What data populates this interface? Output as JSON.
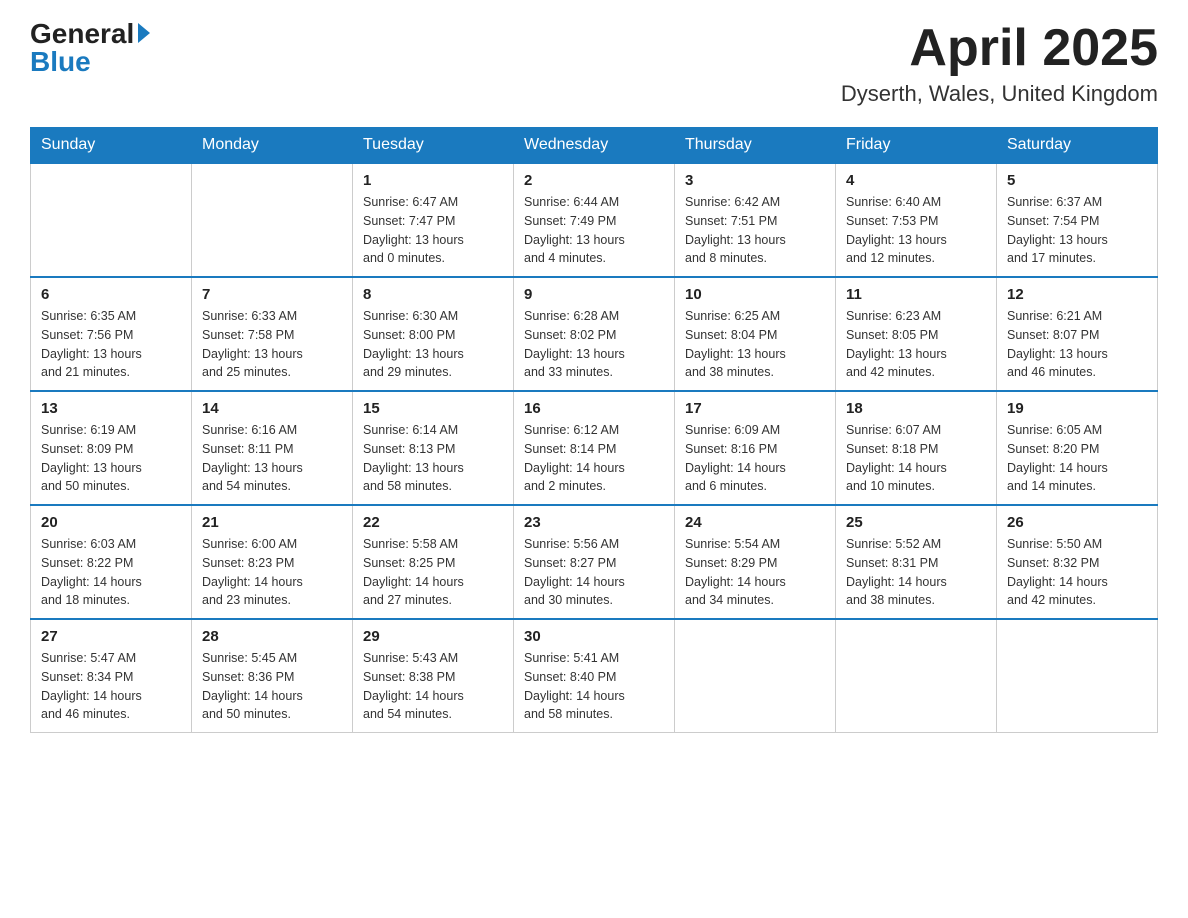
{
  "logo": {
    "general": "General",
    "blue": "Blue"
  },
  "title": {
    "month_year": "April 2025",
    "location": "Dyserth, Wales, United Kingdom"
  },
  "days_of_week": [
    "Sunday",
    "Monday",
    "Tuesday",
    "Wednesday",
    "Thursday",
    "Friday",
    "Saturday"
  ],
  "weeks": [
    [
      {
        "day": "",
        "info": ""
      },
      {
        "day": "",
        "info": ""
      },
      {
        "day": "1",
        "info": "Sunrise: 6:47 AM\nSunset: 7:47 PM\nDaylight: 13 hours\nand 0 minutes."
      },
      {
        "day": "2",
        "info": "Sunrise: 6:44 AM\nSunset: 7:49 PM\nDaylight: 13 hours\nand 4 minutes."
      },
      {
        "day": "3",
        "info": "Sunrise: 6:42 AM\nSunset: 7:51 PM\nDaylight: 13 hours\nand 8 minutes."
      },
      {
        "day": "4",
        "info": "Sunrise: 6:40 AM\nSunset: 7:53 PM\nDaylight: 13 hours\nand 12 minutes."
      },
      {
        "day": "5",
        "info": "Sunrise: 6:37 AM\nSunset: 7:54 PM\nDaylight: 13 hours\nand 17 minutes."
      }
    ],
    [
      {
        "day": "6",
        "info": "Sunrise: 6:35 AM\nSunset: 7:56 PM\nDaylight: 13 hours\nand 21 minutes."
      },
      {
        "day": "7",
        "info": "Sunrise: 6:33 AM\nSunset: 7:58 PM\nDaylight: 13 hours\nand 25 minutes."
      },
      {
        "day": "8",
        "info": "Sunrise: 6:30 AM\nSunset: 8:00 PM\nDaylight: 13 hours\nand 29 minutes."
      },
      {
        "day": "9",
        "info": "Sunrise: 6:28 AM\nSunset: 8:02 PM\nDaylight: 13 hours\nand 33 minutes."
      },
      {
        "day": "10",
        "info": "Sunrise: 6:25 AM\nSunset: 8:04 PM\nDaylight: 13 hours\nand 38 minutes."
      },
      {
        "day": "11",
        "info": "Sunrise: 6:23 AM\nSunset: 8:05 PM\nDaylight: 13 hours\nand 42 minutes."
      },
      {
        "day": "12",
        "info": "Sunrise: 6:21 AM\nSunset: 8:07 PM\nDaylight: 13 hours\nand 46 minutes."
      }
    ],
    [
      {
        "day": "13",
        "info": "Sunrise: 6:19 AM\nSunset: 8:09 PM\nDaylight: 13 hours\nand 50 minutes."
      },
      {
        "day": "14",
        "info": "Sunrise: 6:16 AM\nSunset: 8:11 PM\nDaylight: 13 hours\nand 54 minutes."
      },
      {
        "day": "15",
        "info": "Sunrise: 6:14 AM\nSunset: 8:13 PM\nDaylight: 13 hours\nand 58 minutes."
      },
      {
        "day": "16",
        "info": "Sunrise: 6:12 AM\nSunset: 8:14 PM\nDaylight: 14 hours\nand 2 minutes."
      },
      {
        "day": "17",
        "info": "Sunrise: 6:09 AM\nSunset: 8:16 PM\nDaylight: 14 hours\nand 6 minutes."
      },
      {
        "day": "18",
        "info": "Sunrise: 6:07 AM\nSunset: 8:18 PM\nDaylight: 14 hours\nand 10 minutes."
      },
      {
        "day": "19",
        "info": "Sunrise: 6:05 AM\nSunset: 8:20 PM\nDaylight: 14 hours\nand 14 minutes."
      }
    ],
    [
      {
        "day": "20",
        "info": "Sunrise: 6:03 AM\nSunset: 8:22 PM\nDaylight: 14 hours\nand 18 minutes."
      },
      {
        "day": "21",
        "info": "Sunrise: 6:00 AM\nSunset: 8:23 PM\nDaylight: 14 hours\nand 23 minutes."
      },
      {
        "day": "22",
        "info": "Sunrise: 5:58 AM\nSunset: 8:25 PM\nDaylight: 14 hours\nand 27 minutes."
      },
      {
        "day": "23",
        "info": "Sunrise: 5:56 AM\nSunset: 8:27 PM\nDaylight: 14 hours\nand 30 minutes."
      },
      {
        "day": "24",
        "info": "Sunrise: 5:54 AM\nSunset: 8:29 PM\nDaylight: 14 hours\nand 34 minutes."
      },
      {
        "day": "25",
        "info": "Sunrise: 5:52 AM\nSunset: 8:31 PM\nDaylight: 14 hours\nand 38 minutes."
      },
      {
        "day": "26",
        "info": "Sunrise: 5:50 AM\nSunset: 8:32 PM\nDaylight: 14 hours\nand 42 minutes."
      }
    ],
    [
      {
        "day": "27",
        "info": "Sunrise: 5:47 AM\nSunset: 8:34 PM\nDaylight: 14 hours\nand 46 minutes."
      },
      {
        "day": "28",
        "info": "Sunrise: 5:45 AM\nSunset: 8:36 PM\nDaylight: 14 hours\nand 50 minutes."
      },
      {
        "day": "29",
        "info": "Sunrise: 5:43 AM\nSunset: 8:38 PM\nDaylight: 14 hours\nand 54 minutes."
      },
      {
        "day": "30",
        "info": "Sunrise: 5:41 AM\nSunset: 8:40 PM\nDaylight: 14 hours\nand 58 minutes."
      },
      {
        "day": "",
        "info": ""
      },
      {
        "day": "",
        "info": ""
      },
      {
        "day": "",
        "info": ""
      }
    ]
  ]
}
